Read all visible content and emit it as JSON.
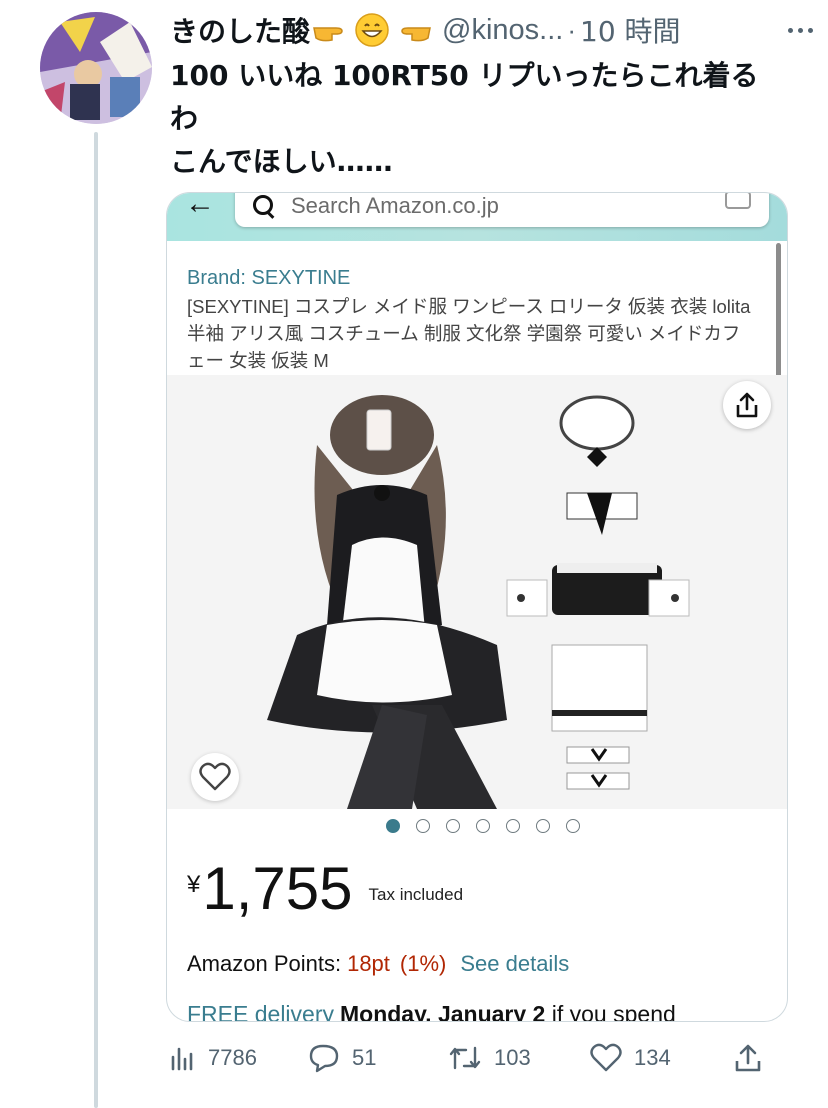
{
  "tweet": {
    "author_name": "きのした酸",
    "handle": "@kinos...",
    "separator": "·",
    "time": "10 時間",
    "text_lines": [
      "100 いいね 100RT50 リプいったらこれ着る",
      "わ",
      "こんでほしい……"
    ]
  },
  "card": {
    "search_placeholder": "Search Amazon.co.jp",
    "brand": "Brand: SEXYTINE",
    "product_title": "[SEXYTINE] コスプレ メイド服 ワンピース ロリータ 仮装 衣装 lolita 半袖 アリス風 コスチューム 制服 文化祭 学園祭 可愛い メイドカフェー 女装 仮装 M",
    "image_count": 7,
    "active_image": 1,
    "currency_symbol": "¥",
    "price": "1,755",
    "tax_note": "Tax included",
    "points_label": "Amazon Points:",
    "points_value": "18pt",
    "points_percent": "(1%)",
    "points_link": "See details",
    "delivery_free": "FREE delivery",
    "delivery_date": "Monday, January 2",
    "delivery_rest": " if you spend"
  },
  "actions": {
    "views": "7786",
    "replies": "51",
    "retweets": "103",
    "likes": "134"
  },
  "colors": {
    "link_teal": "#3a7d8f",
    "price_red": "#b12704",
    "muted": "#536471",
    "header_teal": "#a9e4e0"
  },
  "icons": [
    "more-icon",
    "search-icon",
    "camera-icon",
    "share-icon",
    "heart-icon",
    "views-icon",
    "reply-icon",
    "retweet-icon",
    "like-icon",
    "share-tweet-icon"
  ]
}
